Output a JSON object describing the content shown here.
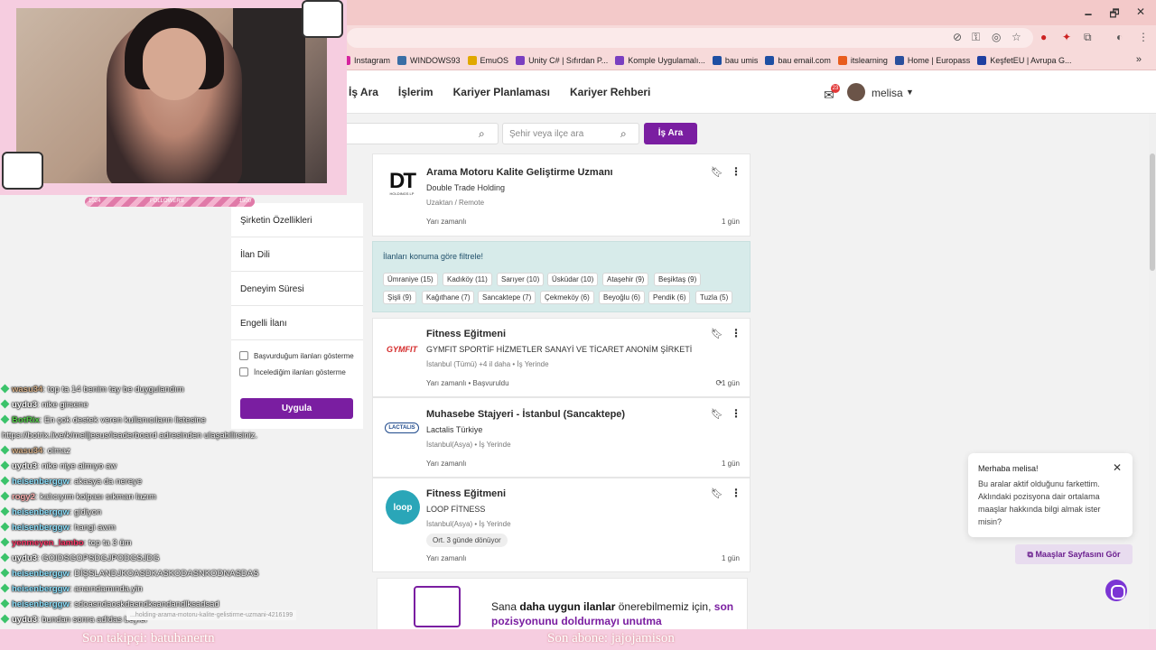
{
  "browser": {
    "window_controls": [
      "🗕",
      "🗗",
      "✕"
    ],
    "bookmarks": [
      {
        "label": "Instagram",
        "color": "#d6249f"
      },
      {
        "label": "WINDOWS93",
        "color": "#3a6ea5"
      },
      {
        "label": "EmuOS",
        "color": "#e0a800"
      },
      {
        "label": "Unity C# | Sıfırdan P...",
        "color": "#7a3fc0"
      },
      {
        "label": "Komple Uygulamalı...",
        "color": "#7a3fc0"
      },
      {
        "label": "bau umis",
        "color": "#1e4fa3"
      },
      {
        "label": "bau email.com",
        "color": "#1e4fa3"
      },
      {
        "label": "itslearning",
        "color": "#e85d1e"
      },
      {
        "label": "Home | Europass",
        "color": "#2a4f9c"
      },
      {
        "label": "KeşfetEU | Avrupa G...",
        "color": "#1f3fa0"
      }
    ],
    "bookmarks_more": "»"
  },
  "header": {
    "nav": [
      "İş Ara",
      "İşlerim",
      "Kariyer Planlaması",
      "Kariyer Rehberi"
    ],
    "mail_badge": "23",
    "username": "melisa"
  },
  "search": {
    "location_placeholder": "Şehir veya ilçe ara",
    "button": "İş Ara"
  },
  "filters": {
    "items": [
      "Şirketin Özellikleri",
      "İlan Dili",
      "Deneyim Süresi",
      "Engelli İlanı"
    ],
    "checkbox1": "Başvurduğum ilanları gösterme",
    "checkbox2": "İncelediğim ilanları gösterme",
    "apply": "Uygula"
  },
  "jobs": [
    {
      "title": "Arama Motoru Kalite Geliştirme Uzmanı",
      "company": "Double Trade Holding",
      "meta": "Uzaktan / Remote",
      "posted": "Yarı zamanlı",
      "age": "1 gün"
    },
    {
      "title": "Fitness Eğitmeni",
      "company": "GYMFIT SPORTİF HİZMETLER SANAYİ VE TİCARET ANONİM ŞİRKETİ",
      "meta": "İstanbul (Tümü) +4 il daha • İş Yerinde",
      "posted": "Yarı zamanlı • Başvuruldu",
      "age": "1 gün"
    },
    {
      "title": "Muhasebe Stajyeri - İstanbul (Sancaktepe)",
      "company": "Lactalis Türkiye",
      "meta": "İstanbul(Asya) • İş Yerinde",
      "posted": "Yarı zamanlı",
      "age": "1 gün"
    },
    {
      "title": "Fitness Eğitmeni",
      "company": "LOOP FİTNESS",
      "meta": "İstanbul(Asya) • İş Yerinde",
      "tag": "Ort. 3 günde dönüyor",
      "posted": "Yarı zamanlı",
      "age": "1 gün"
    }
  ],
  "location_filter": {
    "title": "İlanları konuma göre filtrele!",
    "chips": [
      "Ümraniye (15)",
      "Kadıköy (11)",
      "Sarıyer (10)",
      "Üsküdar (10)",
      "Ataşehir (9)",
      "Beşiktaş (9)",
      "Şişli (9)",
      "Kağıthane (7)",
      "Sancaktepe (7)",
      "Çekmeköy (6)",
      "Beyoğlu (6)",
      "Pendik (6)",
      "Tuzla (5)"
    ]
  },
  "logos": {
    "dt": "DT",
    "dt_sub": "HOLDINGS LP",
    "gymfit": "GYMFIT",
    "lactalis": "LACTALIS",
    "loop": "loop"
  },
  "promo": {
    "text_pre": "Sana ",
    "text_bold": "daha uygun ilanlar",
    "text_mid": " önerebilmemiz için, ",
    "text_hl": "son",
    "line2": "pozisyonunu doldurmayı unutma"
  },
  "salary_popup": {
    "title": "Merhaba melisa!",
    "body": "Bu aralar aktif olduğunu farkettim. Aklındaki pozisyona dair ortalama maaşlar hakkında bilgi almak ister misin?",
    "button": "Maaşlar Sayfasını Gör"
  },
  "status_url": "...holding-arama-motoru-kalite-gelistirme-uzmani-4216199",
  "stream": {
    "followers_left": "1024",
    "followers_label": "FOLLOWERS",
    "followers_right": "1500",
    "chat": [
      {
        "name": "wasu34",
        "msg": ": top ta 14 benim tay be duygulandım",
        "color": "#d9b38c"
      },
      {
        "name": "uydu3",
        "msg": ": nike girsene",
        "color": "#ffffff"
      },
      {
        "name": "BotRix",
        "msg": ": En çok destek veren kullanıcıların listesine",
        "color": "#54d14a"
      },
      {
        "name": "",
        "msg": "https://botrix.live/k/melljesus/leaderboard adresinden ulaşabilirsiniz.",
        "color": "#ffffff"
      },
      {
        "name": "wasu34",
        "msg": ": olmaz",
        "color": "#d9b38c"
      },
      {
        "name": "uydu3",
        "msg": ": nike niye almıyo aw",
        "color": "#ffffff"
      },
      {
        "name": "heisenberggw",
        "msg": ": akasya da nereye",
        "color": "#8fe3ff"
      },
      {
        "name": "rogy2",
        "msg": ": kalıcıyım kolpası sıkman lazım",
        "color": "#ffb3b3"
      },
      {
        "name": "heisenberggw",
        "msg": ": gidiyon",
        "color": "#8fe3ff"
      },
      {
        "name": "heisenberggw",
        "msg": ": hangi awm",
        "color": "#8fe3ff"
      },
      {
        "name": "yenmeyen_lambo",
        "msg": ": top ta 3 üm",
        "color": "#ff3b6b"
      },
      {
        "name": "uydu3",
        "msg": ": GOIDSGOPSDGJPODGSJDG",
        "color": "#ffffff"
      },
      {
        "name": "heisenberggw",
        "msg": ": DİŞSLANDJKOASDKASKODASNKODNASDAS",
        "color": "#8fe3ff"
      },
      {
        "name": "heisenberggw",
        "msg": ": anaındamında.yin",
        "color": "#8fe3ff"
      },
      {
        "name": "heisenberggw",
        "msg": ": sdoasndaoskdasndksandandlksadsad",
        "color": "#8fe3ff"
      },
      {
        "name": "uydu3",
        "msg": ": bundan sonra adidas beyler",
        "color": "#ffffff"
      }
    ],
    "last_follower": "Son takipçi: batuhanertn",
    "last_sub": "Son abone: jajojamison"
  }
}
